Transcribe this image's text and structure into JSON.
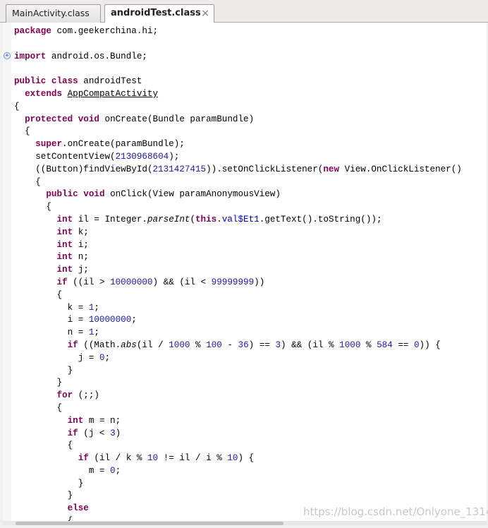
{
  "tabs": [
    {
      "label": "MainActivity.class"
    },
    {
      "label": "androidTest.class",
      "close": "×"
    }
  ],
  "editor": {
    "fold_marker": "+",
    "lines": [
      {
        "indent": 0,
        "segs": [
          [
            "kw",
            "package"
          ],
          [
            "t",
            " com.geekerchina.hi;"
          ]
        ]
      },
      {
        "indent": 0,
        "segs": []
      },
      {
        "indent": 0,
        "segs": [
          [
            "kw",
            "import"
          ],
          [
            "t",
            " android.os.Bundle;"
          ]
        ]
      },
      {
        "indent": 0,
        "segs": []
      },
      {
        "indent": 0,
        "segs": [
          [
            "kw",
            "public"
          ],
          [
            "t",
            " "
          ],
          [
            "kw",
            "class"
          ],
          [
            "t",
            " androidTest"
          ]
        ]
      },
      {
        "indent": 2,
        "segs": [
          [
            "kw",
            "extends"
          ],
          [
            "t",
            " "
          ],
          [
            "link",
            "AppCompatActivity"
          ]
        ]
      },
      {
        "indent": 0,
        "segs": [
          [
            "t",
            "{"
          ]
        ]
      },
      {
        "indent": 2,
        "segs": [
          [
            "kw",
            "protected"
          ],
          [
            "t",
            " "
          ],
          [
            "kw",
            "void"
          ],
          [
            "t",
            " onCreate(Bundle paramBundle)"
          ]
        ]
      },
      {
        "indent": 2,
        "segs": [
          [
            "t",
            "{"
          ]
        ]
      },
      {
        "indent": 4,
        "segs": [
          [
            "kw",
            "super"
          ],
          [
            "t",
            ".onCreate(paramBundle);"
          ]
        ]
      },
      {
        "indent": 4,
        "segs": [
          [
            "t",
            "setContentView("
          ],
          [
            "num",
            "2130968604"
          ],
          [
            "t",
            ");"
          ]
        ]
      },
      {
        "indent": 4,
        "segs": [
          [
            "t",
            "((Button)findViewById("
          ],
          [
            "num",
            "2131427415"
          ],
          [
            "t",
            ")).setOnClickListener("
          ],
          [
            "kw",
            "new"
          ],
          [
            "t",
            " View.OnClickListener()"
          ]
        ]
      },
      {
        "indent": 4,
        "segs": [
          [
            "t",
            "{"
          ]
        ]
      },
      {
        "indent": 6,
        "segs": [
          [
            "kw",
            "public"
          ],
          [
            "t",
            " "
          ],
          [
            "kw",
            "void"
          ],
          [
            "t",
            " onClick(View paramAnonymousView)"
          ]
        ]
      },
      {
        "indent": 6,
        "segs": [
          [
            "t",
            "{"
          ]
        ]
      },
      {
        "indent": 8,
        "segs": [
          [
            "kw",
            "int"
          ],
          [
            "t",
            " il = Integer."
          ],
          [
            "it",
            "parseInt"
          ],
          [
            "t",
            "("
          ],
          [
            "kw",
            "this"
          ],
          [
            "t",
            "."
          ],
          [
            "fld",
            "val$Et1"
          ],
          [
            "t",
            ".getText().toString());"
          ]
        ]
      },
      {
        "indent": 8,
        "segs": [
          [
            "kw",
            "int"
          ],
          [
            "t",
            " k;"
          ]
        ]
      },
      {
        "indent": 8,
        "segs": [
          [
            "kw",
            "int"
          ],
          [
            "t",
            " i;"
          ]
        ]
      },
      {
        "indent": 8,
        "segs": [
          [
            "kw",
            "int"
          ],
          [
            "t",
            " n;"
          ]
        ]
      },
      {
        "indent": 8,
        "segs": [
          [
            "kw",
            "int"
          ],
          [
            "t",
            " j;"
          ]
        ]
      },
      {
        "indent": 8,
        "segs": [
          [
            "kw",
            "if"
          ],
          [
            "t",
            " ((il > "
          ],
          [
            "num",
            "10000000"
          ],
          [
            "t",
            ") && (il < "
          ],
          [
            "num",
            "99999999"
          ],
          [
            "t",
            "))"
          ]
        ]
      },
      {
        "indent": 8,
        "segs": [
          [
            "t",
            "{"
          ]
        ]
      },
      {
        "indent": 10,
        "segs": [
          [
            "t",
            "k = "
          ],
          [
            "num",
            "1"
          ],
          [
            "t",
            ";"
          ]
        ]
      },
      {
        "indent": 10,
        "segs": [
          [
            "t",
            "i = "
          ],
          [
            "num",
            "10000000"
          ],
          [
            "t",
            ";"
          ]
        ]
      },
      {
        "indent": 10,
        "segs": [
          [
            "t",
            "n = "
          ],
          [
            "num",
            "1"
          ],
          [
            "t",
            ";"
          ]
        ]
      },
      {
        "indent": 10,
        "segs": [
          [
            "kw",
            "if"
          ],
          [
            "t",
            " ((Math."
          ],
          [
            "it",
            "abs"
          ],
          [
            "t",
            "(il / "
          ],
          [
            "num",
            "1000"
          ],
          [
            "t",
            " % "
          ],
          [
            "num",
            "100"
          ],
          [
            "t",
            " - "
          ],
          [
            "num",
            "36"
          ],
          [
            "t",
            ") == "
          ],
          [
            "num",
            "3"
          ],
          [
            "t",
            ") && (il % "
          ],
          [
            "num",
            "1000"
          ],
          [
            "t",
            " % "
          ],
          [
            "num",
            "584"
          ],
          [
            "t",
            " == "
          ],
          [
            "num",
            "0"
          ],
          [
            "t",
            ")) {"
          ]
        ]
      },
      {
        "indent": 12,
        "segs": [
          [
            "t",
            "j = "
          ],
          [
            "num",
            "0"
          ],
          [
            "t",
            ";"
          ]
        ]
      },
      {
        "indent": 10,
        "segs": [
          [
            "t",
            "}"
          ]
        ]
      },
      {
        "indent": 8,
        "segs": [
          [
            "t",
            "}"
          ]
        ]
      },
      {
        "indent": 8,
        "segs": [
          [
            "kw",
            "for"
          ],
          [
            "t",
            " (;;)"
          ]
        ]
      },
      {
        "indent": 8,
        "segs": [
          [
            "t",
            "{"
          ]
        ]
      },
      {
        "indent": 10,
        "segs": [
          [
            "kw",
            "int"
          ],
          [
            "t",
            " m = n;"
          ]
        ]
      },
      {
        "indent": 10,
        "segs": [
          [
            "kw",
            "if"
          ],
          [
            "t",
            " (j < "
          ],
          [
            "num",
            "3"
          ],
          [
            "t",
            ")"
          ]
        ]
      },
      {
        "indent": 10,
        "segs": [
          [
            "t",
            "{"
          ]
        ]
      },
      {
        "indent": 12,
        "segs": [
          [
            "kw",
            "if"
          ],
          [
            "t",
            " (il / k % "
          ],
          [
            "num",
            "10"
          ],
          [
            "t",
            " != il / i % "
          ],
          [
            "num",
            "10"
          ],
          [
            "t",
            ") {"
          ]
        ]
      },
      {
        "indent": 14,
        "segs": [
          [
            "t",
            "m = "
          ],
          [
            "num",
            "0"
          ],
          [
            "t",
            ";"
          ]
        ]
      },
      {
        "indent": 12,
        "segs": [
          [
            "t",
            "}"
          ]
        ]
      },
      {
        "indent": 10,
        "segs": [
          [
            "t",
            "}"
          ]
        ]
      },
      {
        "indent": 10,
        "segs": [
          [
            "kw",
            "else"
          ]
        ]
      },
      {
        "indent": 10,
        "segs": [
          [
            "t",
            "{"
          ]
        ]
      }
    ]
  },
  "watermark": "https://blog.csdn.net/Onlyone_1314"
}
